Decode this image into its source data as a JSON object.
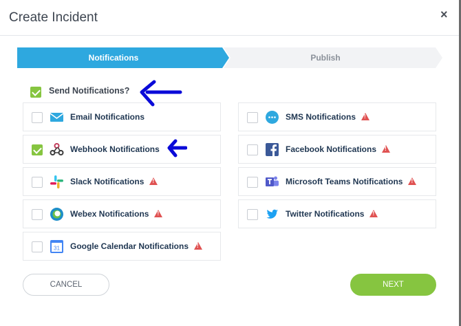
{
  "dialog": {
    "title": "Create Incident",
    "close_symbol": "×"
  },
  "steps": [
    {
      "label": "Notifications",
      "active": true
    },
    {
      "label": "Publish",
      "active": false
    }
  ],
  "send_notifications": {
    "label": "Send Notifications?",
    "checked": true
  },
  "channels": {
    "email": {
      "label": "Email Notifications",
      "checked": false,
      "warning": false,
      "icon": "mail-icon"
    },
    "sms": {
      "label": "SMS Notifications",
      "checked": false,
      "warning": true,
      "icon": "sms-chat-icon"
    },
    "webhook": {
      "label": "Webhook Notifications",
      "checked": true,
      "warning": false,
      "icon": "webhook-icon"
    },
    "facebook": {
      "label": "Facebook Notifications",
      "checked": false,
      "warning": true,
      "icon": "facebook-icon"
    },
    "slack": {
      "label": "Slack Notifications",
      "checked": false,
      "warning": true,
      "icon": "slack-icon"
    },
    "teams": {
      "label": "Microsoft Teams Notifications",
      "checked": false,
      "warning": true,
      "icon": "microsoft-teams-icon"
    },
    "webex": {
      "label": "Webex Notifications",
      "checked": false,
      "warning": true,
      "icon": "webex-icon"
    },
    "twitter": {
      "label": "Twitter Notifications",
      "checked": false,
      "warning": true,
      "icon": "twitter-icon"
    },
    "gcal": {
      "label": "Google Calendar Notifications",
      "checked": false,
      "warning": true,
      "icon": "google-calendar-icon",
      "icon_text": "31"
    }
  },
  "buttons": {
    "cancel": "CANCEL",
    "next": "NEXT"
  },
  "colors": {
    "accent_blue": "#2ea8df",
    "check_green": "#86c540",
    "warning_red": "#e05252",
    "annotation_arrow": "#0a0ad8"
  }
}
